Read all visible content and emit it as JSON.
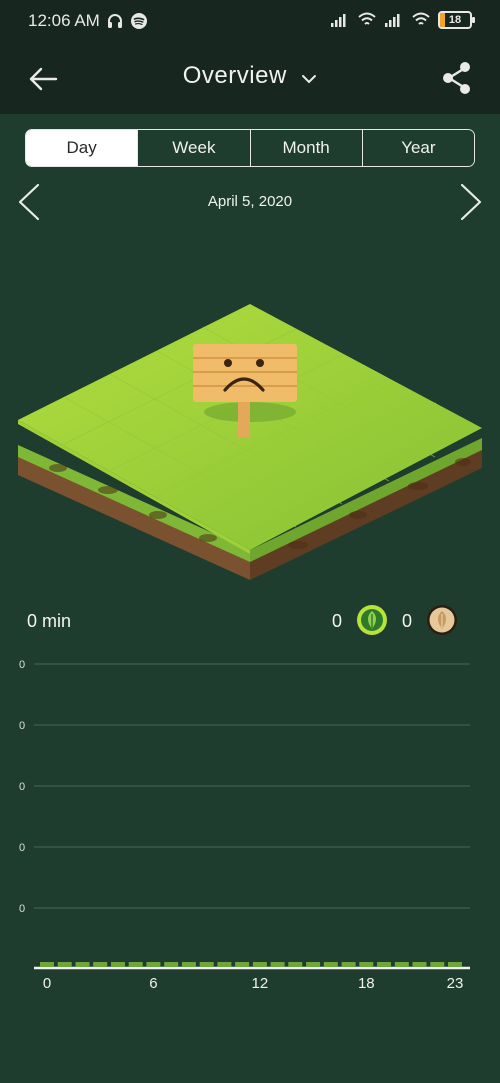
{
  "status_bar": {
    "time": "12:06 AM",
    "battery": "18"
  },
  "header": {
    "title": "Overview"
  },
  "tabs": [
    {
      "label": "Day",
      "active": true
    },
    {
      "label": "Week",
      "active": false
    },
    {
      "label": "Month",
      "active": false
    },
    {
      "label": "Year",
      "active": false
    }
  ],
  "date": "April 5, 2020",
  "summary": {
    "focus_time": "0 min",
    "healthy_trees": "0",
    "dead_trees": "0"
  },
  "colors": {
    "background": "#1f3d2e",
    "bar": "#6fa63a",
    "healthy_tree": "#b6e23a",
    "dead_tree": "#e6c99a"
  },
  "chart_data": {
    "type": "bar",
    "x": [
      0,
      1,
      2,
      3,
      4,
      5,
      6,
      7,
      8,
      9,
      10,
      11,
      12,
      13,
      14,
      15,
      16,
      17,
      18,
      19,
      20,
      21,
      22,
      23
    ],
    "values": [
      0,
      0,
      0,
      0,
      0,
      0,
      0,
      0,
      0,
      0,
      0,
      0,
      0,
      0,
      0,
      0,
      0,
      0,
      0,
      0,
      0,
      0,
      0,
      0
    ],
    "xticks": [
      "0",
      "6",
      "12",
      "18",
      "23"
    ],
    "yticks": [
      "0",
      "0",
      "0",
      "0",
      "0"
    ],
    "grid": true
  }
}
